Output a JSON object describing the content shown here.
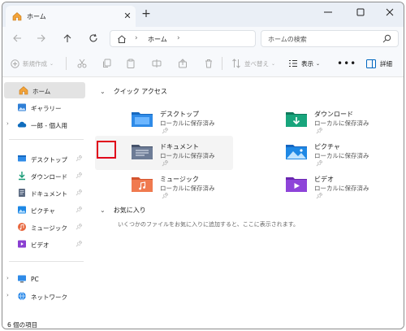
{
  "tab": {
    "title": "ホーム"
  },
  "address": {
    "crumb": "ホーム"
  },
  "search": {
    "placeholder": "ホームの検索"
  },
  "toolbar": {
    "new_label": "新規作成",
    "sort_label": "並べ替え",
    "view_label": "表示",
    "details_label": "詳細"
  },
  "sidebar": {
    "top": [
      {
        "label": "ホーム"
      },
      {
        "label": "ギャラリー"
      },
      {
        "label": "一郎 - 個人用"
      }
    ],
    "pinned": [
      {
        "label": "デスクトップ"
      },
      {
        "label": "ダウンロード"
      },
      {
        "label": "ドキュメント"
      },
      {
        "label": "ピクチャ"
      },
      {
        "label": "ミュージック"
      },
      {
        "label": "ビデオ"
      }
    ],
    "bottom": [
      {
        "label": "PC"
      },
      {
        "label": "ネットワーク"
      }
    ]
  },
  "main": {
    "quick_access_title": "クイック アクセス",
    "favorites_title": "お気に入り",
    "favorites_empty": "いくつかのファイルをお気に入りに追加すると、ここに表示されます。",
    "folders": [
      {
        "name": "デスクトップ",
        "sub": "ローカルに保存済み"
      },
      {
        "name": "ダウンロード",
        "sub": "ローカルに保存済み"
      },
      {
        "name": "ドキュメント",
        "sub": "ローカルに保存済み"
      },
      {
        "name": "ピクチャ",
        "sub": "ローカルに保存済み"
      },
      {
        "name": "ミュージック",
        "sub": "ローカルに保存済み"
      },
      {
        "name": "ビデオ",
        "sub": "ローカルに保存済み"
      }
    ]
  },
  "status": {
    "text": "6 個の項目"
  },
  "colors": {
    "accent": "#0067c0",
    "highlight_box": "#e0001a"
  }
}
